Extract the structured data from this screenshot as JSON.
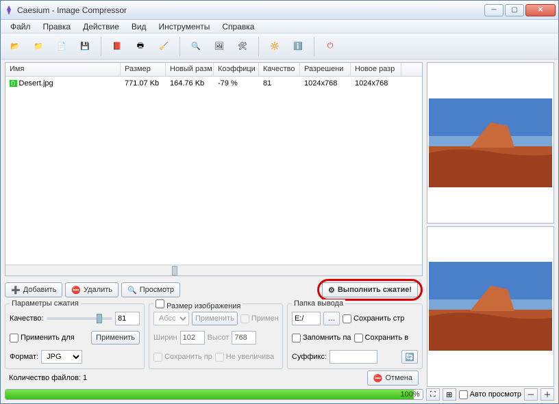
{
  "window": {
    "title": "Caesium - Image Compressor"
  },
  "menu": {
    "file": "Файл",
    "edit": "Правка",
    "action": "Действие",
    "view": "Вид",
    "tools": "Инструменты",
    "help": "Справка"
  },
  "list": {
    "headers": {
      "name": "Имя",
      "size": "Размер",
      "newsize": "Новый разм",
      "ratio": "Коэффици",
      "quality": "Качество",
      "res": "Разрешени",
      "newres": "Новое разр"
    },
    "rows": [
      {
        "name": "Desert.jpg",
        "size": "771.07 Kb",
        "newsize": "164.76 Kb",
        "ratio": "-79 %",
        "quality": "81",
        "res": "1024x768",
        "newres": "1024x768"
      }
    ]
  },
  "buttons": {
    "add": "Добавить",
    "remove": "Удалить",
    "preview": "Просмотр",
    "compress": "Выполнить сжатие!",
    "apply": "Применить",
    "cancel": "Отмена"
  },
  "compression": {
    "legend": "Параметры сжатия",
    "quality_label": "Качество:",
    "quality_value": "81",
    "same_for_all": "Применить для",
    "format_label": "Формат:",
    "format_value": "JPG"
  },
  "resize": {
    "legend": "Размер изображения",
    "abs": "Абсолн",
    "apply": "Применить",
    "apply_chk": "Примен",
    "width_label": "Ширин",
    "width_value": "102",
    "height_label": "Высот",
    "height_value": "768",
    "keep": "Сохранить пр",
    "noenl": "Не увеличива"
  },
  "output": {
    "legend": "Папка вывода",
    "path": "E:/",
    "keep_struct": "Сохранить стр",
    "remember": "Запомнить па",
    "save_in": "Сохранить в",
    "suffix_label": "Суффикс:",
    "suffix_value": ""
  },
  "status": {
    "count_label": "Количество файлов: 1",
    "progress": "100%"
  },
  "footer": {
    "auto_preview": "Авто просмотр"
  },
  "icons": {
    "open": "📂",
    "openfolder": "📁",
    "doc": "📄",
    "save": "💾",
    "docx": "📕",
    "print": "🖶",
    "broom": "🧹",
    "zoom": "🔍",
    "pic": "🖼",
    "wrench": "🛠",
    "sun": "🔆",
    "info": "ℹ️",
    "power": "⏻",
    "plus": "➕",
    "minus": "⛔",
    "eye": "🔍",
    "gear": "⚙",
    "browse": "…",
    "reload": "🔄",
    "fit": "⛶",
    "orig": "⊞",
    "zin": "＋",
    "zout": "－"
  }
}
